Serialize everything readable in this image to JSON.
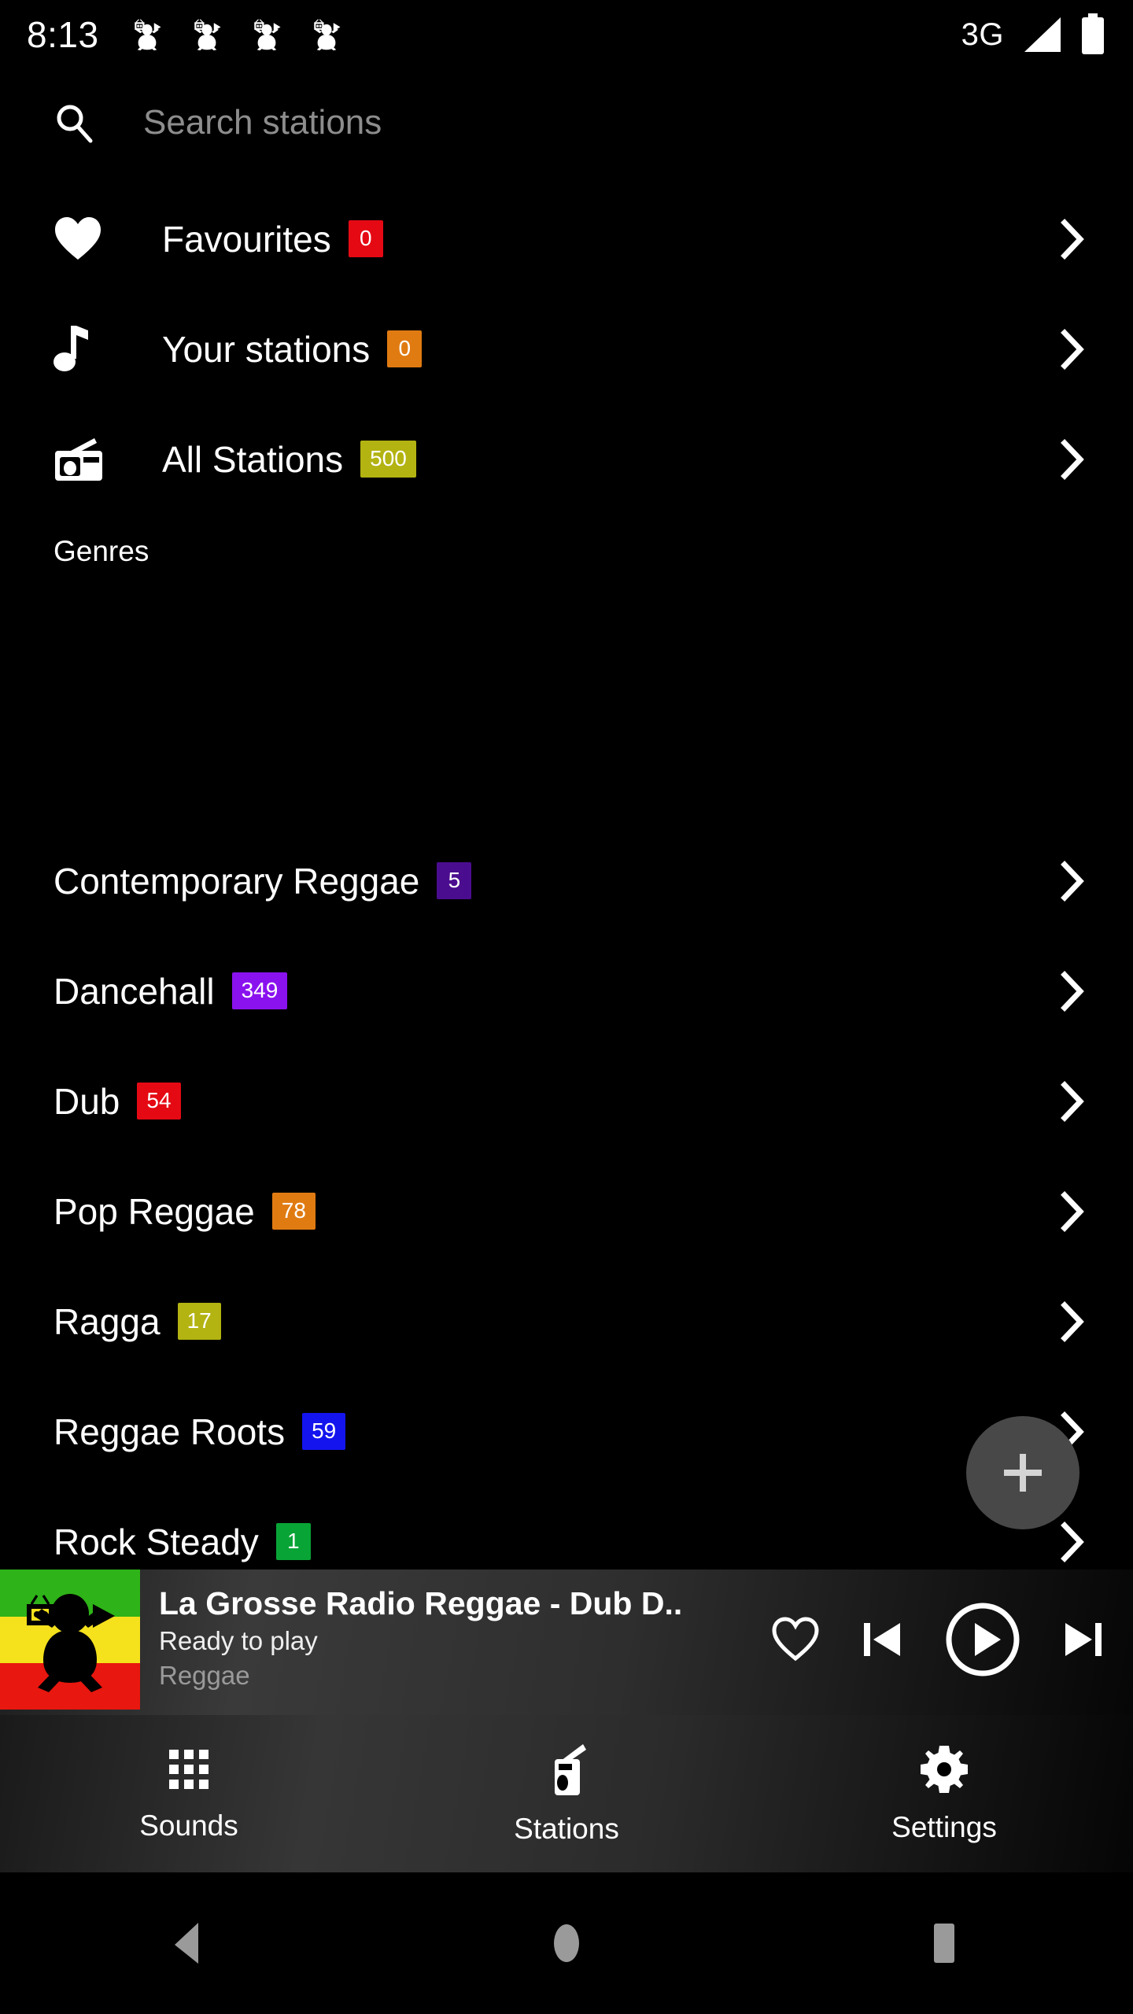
{
  "status_bar": {
    "clock": "8:13",
    "notification_icons": [
      "app-notification-icon",
      "app-notification-icon",
      "app-notification-icon",
      "app-notification-icon"
    ],
    "network": "3G",
    "signal_icon": "signal-triangle-icon",
    "battery_icon": "battery-full-icon"
  },
  "search": {
    "icon": "search-icon",
    "value": "",
    "placeholder": "Search stations"
  },
  "main_list": [
    {
      "icon": "heart-filled-icon",
      "label": "Favourites",
      "badge": "0",
      "badge_color": "#e50914"
    },
    {
      "icon": "music-note-icon",
      "label": "Your stations",
      "badge": "0",
      "badge_color": "#e07b12"
    },
    {
      "icon": "radio-icon",
      "label": "All Stations",
      "badge": "500",
      "badge_color": "#b3b312"
    }
  ],
  "genres_section": {
    "header": "Genres",
    "items": [
      {
        "label": "Contemporary Reggae",
        "badge": "5",
        "badge_color": "#4b0d8f"
      },
      {
        "label": "Dancehall",
        "badge": "349",
        "badge_color": "#8a12ef"
      },
      {
        "label": "Dub",
        "badge": "54",
        "badge_color": "#e50914"
      },
      {
        "label": "Pop Reggae",
        "badge": "78",
        "badge_color": "#e07b12"
      },
      {
        "label": "Ragga",
        "badge": "17",
        "badge_color": "#b3b312"
      },
      {
        "label": "Reggae Roots",
        "badge": "59",
        "badge_color": "#1414ee"
      },
      {
        "label": "Rock Steady",
        "badge": "1",
        "badge_color": "#09a436"
      }
    ]
  },
  "fab": {
    "icon": "plus-icon",
    "color": "#484848"
  },
  "player": {
    "artwork": "rasta-flag-frog-artwork",
    "title": "La Grosse Radio Reggae - Dub D..",
    "status": "Ready to play",
    "genre": "Reggae",
    "controls": [
      {
        "name": "favourite-button",
        "icon": "heart-outline-icon"
      },
      {
        "name": "previous-button",
        "icon": "skip-previous-icon"
      },
      {
        "name": "play-button",
        "icon": "play-circle-icon"
      },
      {
        "name": "next-button",
        "icon": "skip-next-icon"
      }
    ]
  },
  "bottom_nav": [
    {
      "label": "Sounds",
      "icon": "grid-icon"
    },
    {
      "label": "Stations",
      "icon": "radio-icon"
    },
    {
      "label": "Settings",
      "icon": "gear-icon"
    }
  ],
  "system_nav": [
    {
      "name": "back-button",
      "icon": "triangle-back-icon"
    },
    {
      "name": "home-button",
      "icon": "circle-home-icon"
    },
    {
      "name": "recents-button",
      "icon": "square-recents-icon"
    }
  ]
}
